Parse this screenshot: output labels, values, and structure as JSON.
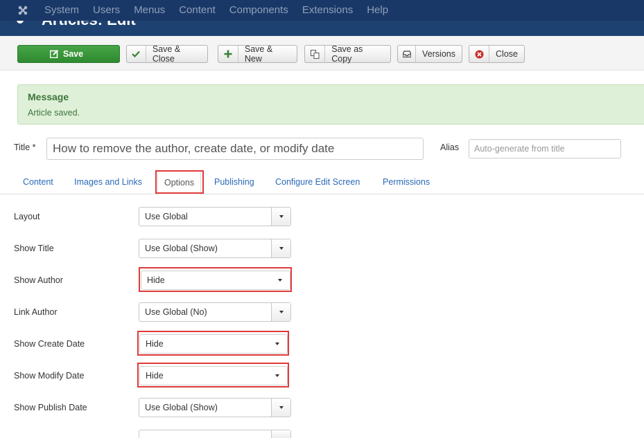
{
  "topnav": {
    "logo_icon": "joomla-logo-icon",
    "items": [
      "System",
      "Users",
      "Menus",
      "Content",
      "Components",
      "Extensions",
      "Help"
    ]
  },
  "page_title": "Articles: Edit",
  "toolbar": {
    "save": "Save",
    "save_close": "Save & Close",
    "save_new": "Save & New",
    "save_copy": "Save as Copy",
    "versions": "Versions",
    "close": "Close"
  },
  "message": {
    "title": "Message",
    "text": "Article saved."
  },
  "form": {
    "title_label": "Title *",
    "title_value": "How to remove the author, create date, or modify date",
    "alias_label": "Alias",
    "alias_placeholder": "Auto-generate from title"
  },
  "tabs": [
    "Content",
    "Images and Links",
    "Options",
    "Publishing",
    "Configure Edit Screen",
    "Permissions"
  ],
  "active_tab": "Options",
  "options": [
    {
      "label": "Layout",
      "value": "Use Global"
    },
    {
      "label": "Show Title",
      "value": "Use Global (Show)"
    },
    {
      "label": "Show Author",
      "value": "Hide"
    },
    {
      "label": "Link Author",
      "value": "Use Global (No)"
    },
    {
      "label": "Show Create Date",
      "value": "Hide"
    },
    {
      "label": "Show Modify Date",
      "value": "Hide"
    },
    {
      "label": "Show Publish Date",
      "value": "Use Global (Show)"
    }
  ],
  "colors": {
    "nav_bg": "#1a3867",
    "save_green": "#3d9a3d",
    "link_blue": "#2a69b8",
    "highlight_red": "#e03a3a",
    "message_bg": "#dff0d8"
  }
}
